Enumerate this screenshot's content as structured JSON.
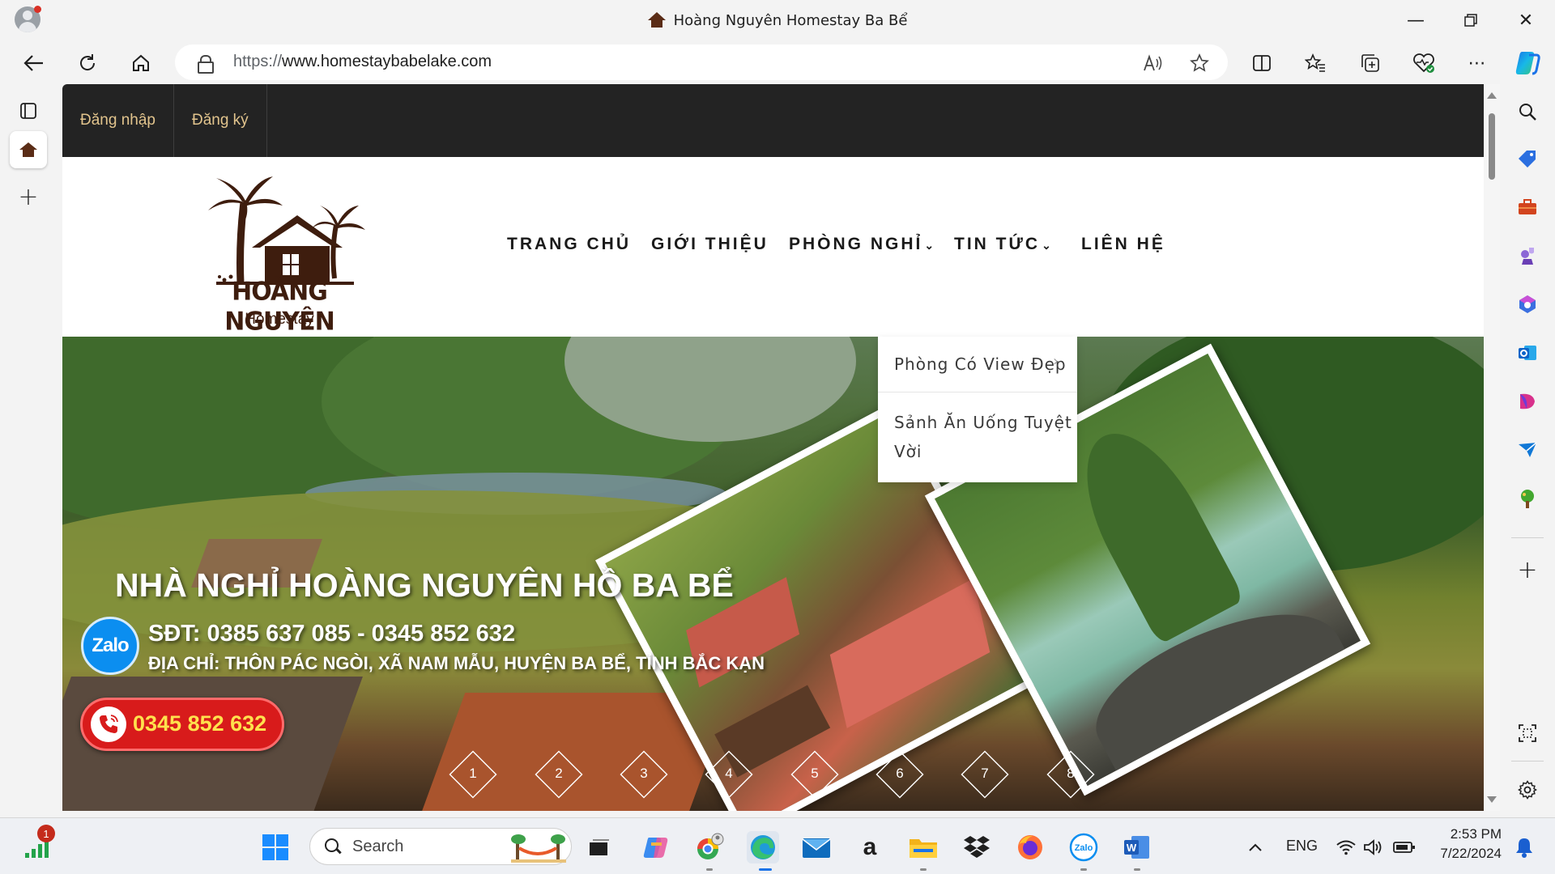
{
  "browser": {
    "tab_title": "Hoàng Nguyên Homestay Ba Bể",
    "url_protocol": "https://",
    "url_host": "www.homestaybabelake.com"
  },
  "site": {
    "topnav": {
      "login": "Đăng nhập",
      "register": "Đăng ký"
    },
    "logo": {
      "name": "HOÀNG NGUYÊN",
      "sub": "Homestay"
    },
    "menu": [
      {
        "label": "TRANG CHỦ"
      },
      {
        "label": "GIỚI THIỆU"
      },
      {
        "label": "PHÒNG NGHỈ",
        "chevron": "⌄"
      },
      {
        "label": "TIN TỨC",
        "chevron": "⌄"
      },
      {
        "label": "LIÊN HỆ"
      }
    ],
    "dropdown": [
      {
        "label": "Phòng Có View Đẹp",
        "arrow": "›"
      },
      {
        "label_line1": "Sảnh Ăn Uống Tuyệt",
        "label_line2": "Vời"
      }
    ],
    "hero": {
      "title": "NHÀ NGHỈ HOÀNG NGUYÊN HỒ BA BỂ",
      "phone_line": "SĐT: 0385 637 085 - 0345 852 632",
      "address_line": "ĐỊA CHỈ: THÔN PÁC NGÒI, XÃ NAM MẪU, HUYỆN BA BỂ, TỈNH BẮC KẠN",
      "zalo_label": "Zalo",
      "call_number": "0345 852 632"
    },
    "slider_dots": [
      "1",
      "2",
      "3",
      "4",
      "5",
      "6",
      "7",
      "8"
    ]
  },
  "taskbar": {
    "search_label": "Search",
    "notification_count": "1",
    "lang": "ENG",
    "time": "2:53 PM",
    "date": "7/22/2024"
  },
  "colors": {
    "topnav_bg": "#232323",
    "topnav_link": "#e2c48d",
    "logo_brown": "#3e1d0e",
    "call_red": "#d81b1b",
    "call_number_yellow": "#ffe14d",
    "zalo_blue": "#0b8ef0"
  }
}
